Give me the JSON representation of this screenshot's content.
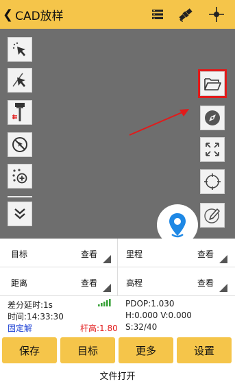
{
  "header": {
    "title": "CAD放样",
    "background": "#f5c54a"
  },
  "icons": {
    "header": [
      "menu-list-icon",
      "satellite-icon",
      "crosshair-icon"
    ],
    "left_tools": [
      "select-arrow-icon",
      "select-arrow-line-icon",
      "survey-pole-icon",
      "clear-selection-icon",
      "add-point-icon",
      "expand-down-icon"
    ],
    "right_tools": [
      "folder-open-icon",
      "compass-icon",
      "zoom-extent-icon",
      "locate-target-icon",
      "edit-note-icon"
    ]
  },
  "info": {
    "cells": [
      {
        "label": "目标",
        "action": "查看"
      },
      {
        "label": "里程",
        "action": "查看"
      },
      {
        "label": "距离",
        "action": "查看"
      },
      {
        "label": "高程",
        "action": "查看"
      }
    ]
  },
  "status": {
    "diff_delay": "差分延时:1s",
    "time": "时间:14:33:30",
    "solution": "固定解",
    "pole_height": "杆高:1.80",
    "pdop": "PDOP:1.030",
    "hv": "H:0.000  V:0.000",
    "sats": "S:32/40",
    "solution_color": "#1a3fd4",
    "pole_color": "#e21a1a",
    "signal_color": "#3aa23a"
  },
  "buttons": {
    "save": "保存",
    "target": "目标",
    "more": "更多",
    "settings": "设置"
  },
  "caption": "文件打开"
}
